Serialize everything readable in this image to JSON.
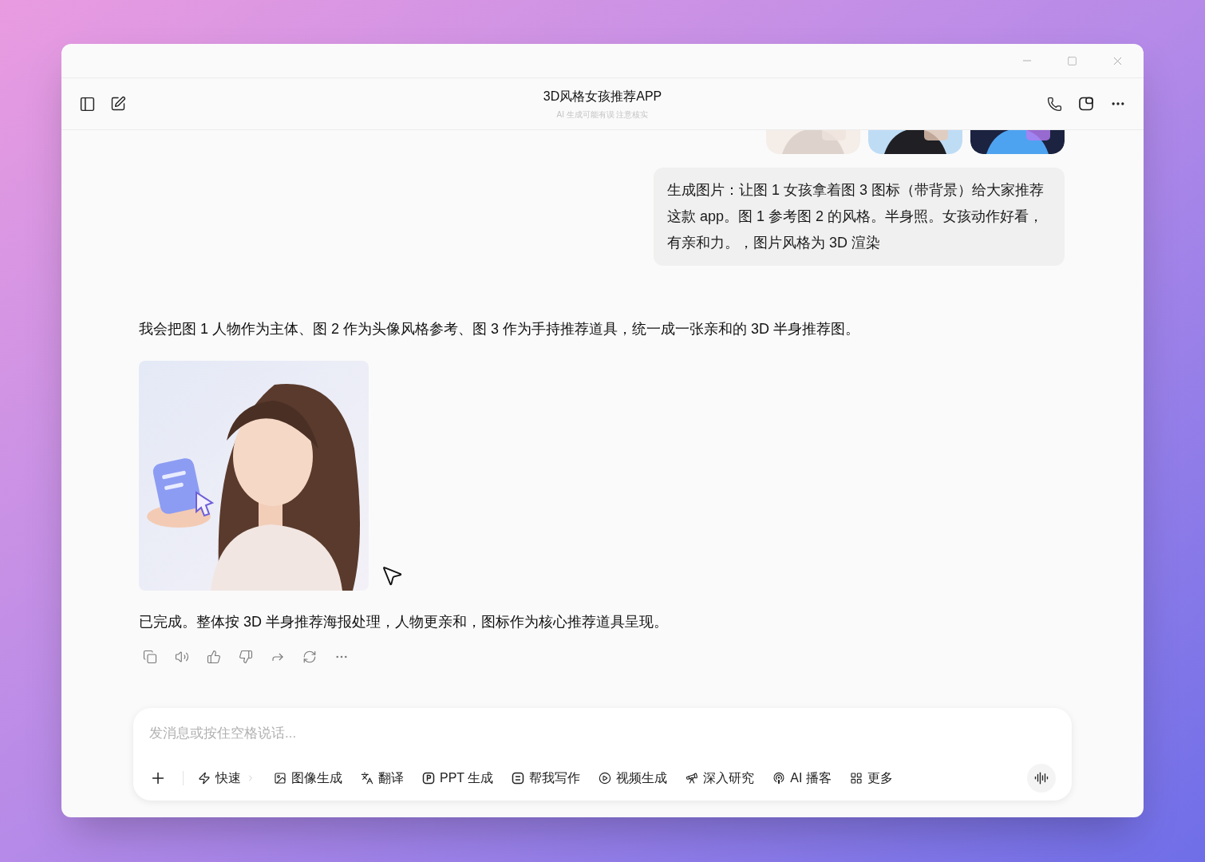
{
  "header": {
    "title": "3D风格女孩推荐APP",
    "subtitle": "AI 生成可能有误 注意核实"
  },
  "user_message": {
    "text": "生成图片：让图 1 女孩拿着图 3 图标（带背景）给大家推荐这款 app。图 1 参考图 2 的风格。半身照。女孩动作好看，有亲和力。，图片风格为 3D 渲染"
  },
  "assistant_message": {
    "intro": "我会把图 1 人物作为主体、图 2 作为头像风格参考、图 3 作为手持推荐道具，统一成一张亲和的 3D 半身推荐图。",
    "summary": "已完成。整体按 3D 半身推荐海报处理，人物更亲和，图标作为核心推荐道具呈现。"
  },
  "composer": {
    "placeholder": "发消息或按住空格说话...",
    "tools": [
      {
        "label": "快速",
        "kind": "mode"
      },
      {
        "label": "图像生成",
        "kind": "tool"
      },
      {
        "label": "翻译",
        "kind": "tool"
      },
      {
        "label": "PPT 生成",
        "kind": "tool"
      },
      {
        "label": "帮我写作",
        "kind": "tool"
      },
      {
        "label": "视频生成",
        "kind": "tool"
      },
      {
        "label": "深入研究",
        "kind": "tool"
      },
      {
        "label": "AI 播客",
        "kind": "tool"
      },
      {
        "label": "更多",
        "kind": "tool"
      }
    ]
  }
}
